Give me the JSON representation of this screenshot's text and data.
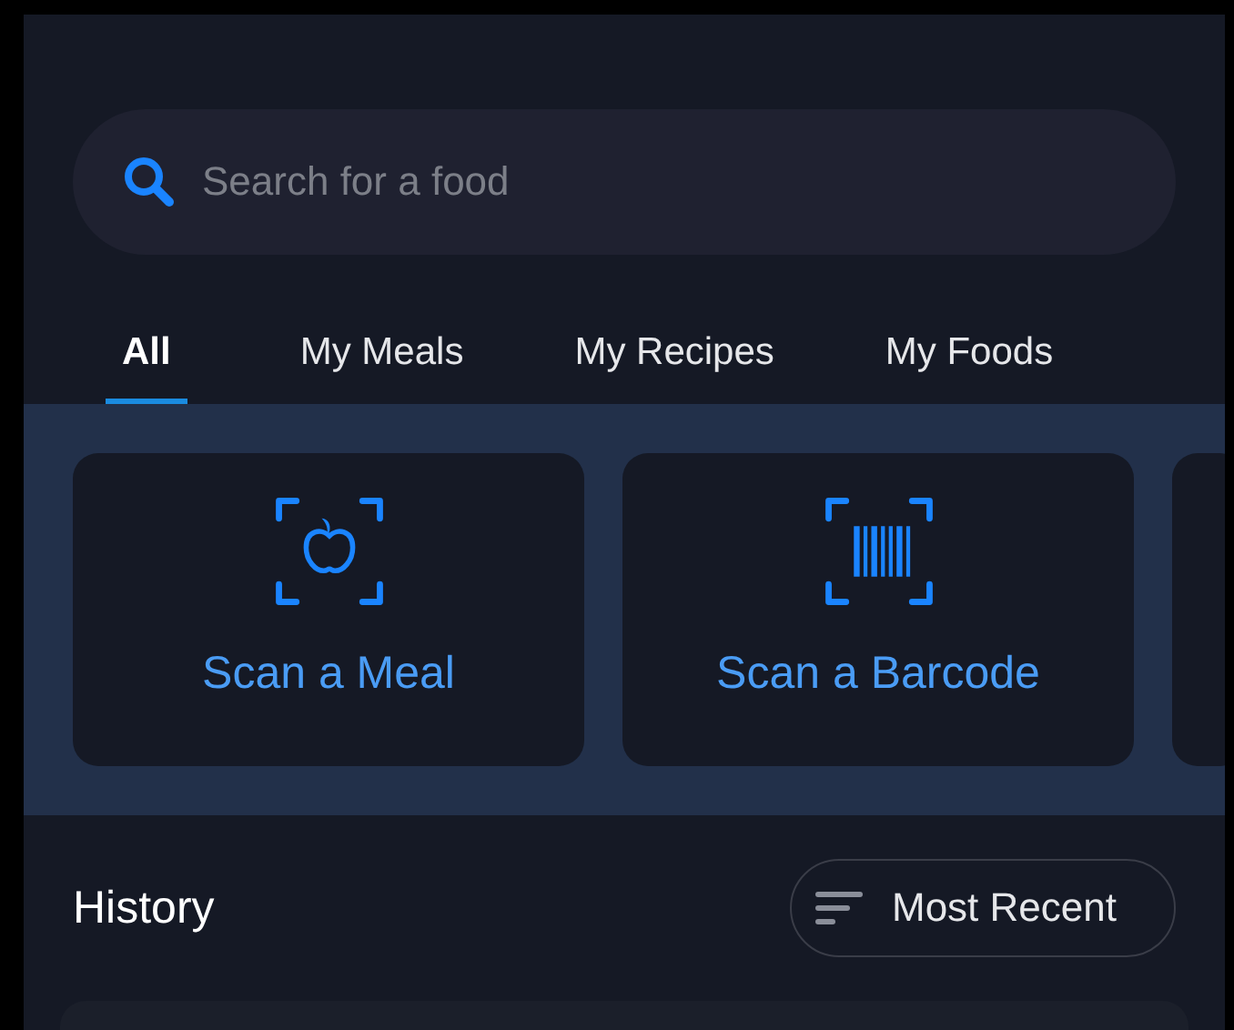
{
  "search": {
    "placeholder": "Search for a food"
  },
  "tabs": [
    {
      "label": "All",
      "selected": true
    },
    {
      "label": "My Meals",
      "selected": false
    },
    {
      "label": "My Recipes",
      "selected": false
    },
    {
      "label": "My Foods",
      "selected": false
    }
  ],
  "scan_actions": [
    {
      "kind": "meal",
      "label": "Scan a Meal"
    },
    {
      "kind": "barcode",
      "label": "Scan a Barcode"
    }
  ],
  "history": {
    "title": "History",
    "sort": "Most Recent"
  }
}
